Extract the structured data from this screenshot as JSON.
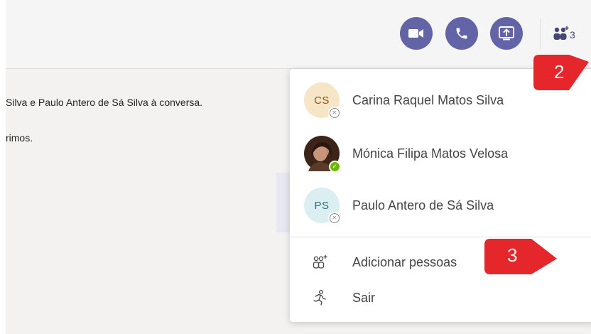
{
  "toolbar": {
    "video_call_icon": "video-camera-icon",
    "audio_call_icon": "phone-icon",
    "share_screen_icon": "share-screen-icon",
    "participants_icon": "people-icon",
    "participants_count": "3"
  },
  "chat": {
    "system_message": "Silva e Paulo Antero de Sá Silva à conversa.",
    "message_fragment": "rimos."
  },
  "participants_popup": {
    "people": [
      {
        "initials": "CS",
        "name": "Carina Raquel Matos Silva",
        "status": "offline",
        "avatar_color": "#f6e5c7"
      },
      {
        "initials": "",
        "name": "Mónica Filipa Matos Velosa",
        "status": "available",
        "avatar_color": "#3c2418"
      },
      {
        "initials": "PS",
        "name": "Paulo Antero de Sá Silva",
        "status": "offline",
        "avatar_color": "#dbeff3"
      }
    ],
    "actions": [
      {
        "label": "Adicionar pessoas",
        "icon": "add-people-icon"
      },
      {
        "label": "Sair",
        "icon": "leave-icon"
      }
    ]
  },
  "callouts": [
    "2",
    "3"
  ],
  "colors": {
    "accent": "#6264a7",
    "callout": "#e5262b",
    "available": "#6bb700"
  }
}
